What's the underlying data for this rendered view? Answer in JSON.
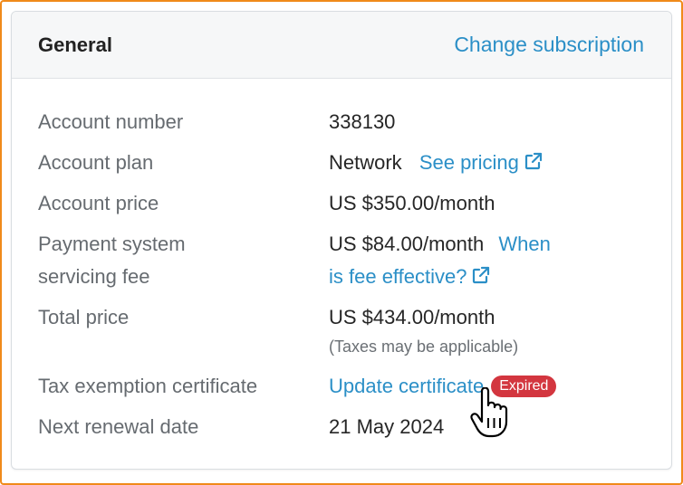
{
  "card": {
    "title": "General",
    "change_subscription": "Change subscription"
  },
  "rows": {
    "account_number": {
      "label": "Account number",
      "value": "338130"
    },
    "account_plan": {
      "label": "Account plan",
      "value": "Network",
      "link": "See pricing",
      "link_icon": "external-link-icon"
    },
    "account_price": {
      "label": "Account price",
      "value": "US $350.00/month"
    },
    "servicing_fee": {
      "label_line1": "Payment system",
      "label_line2": "servicing fee",
      "value": "US $84.00/month",
      "link_line1": "When",
      "link_line2": "is fee effective?",
      "link_icon": "external-link-icon"
    },
    "total_price": {
      "label": "Total price",
      "value": "US $434.00/month",
      "note": "(Taxes may be applicable)"
    },
    "tax_exemption": {
      "label": "Tax exemption certificate",
      "link": "Update certificate",
      "badge": "Expired"
    },
    "renewal": {
      "label": "Next renewal date",
      "value": "21 May 2024"
    }
  },
  "colors": {
    "link": "#2b8fc7",
    "badge": "#d3363f",
    "frame": "#f08a1a",
    "header_bg": "#f6f7f8"
  },
  "cursor": {
    "icon": "hand-pointer-icon"
  }
}
